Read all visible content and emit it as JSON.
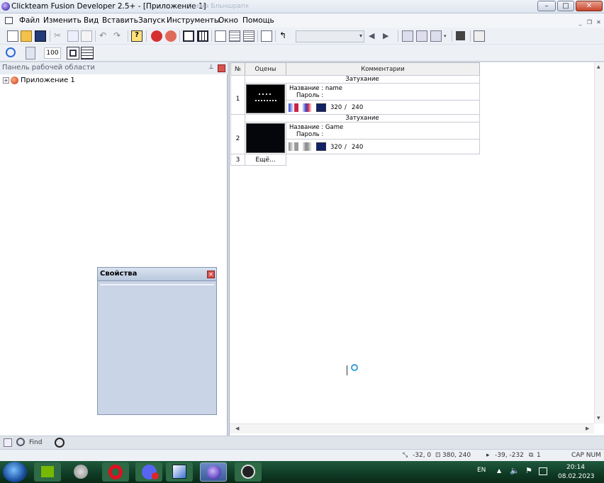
{
  "window": {
    "title": "Clickteam Fusion Developer 2.5+ - [Приложение 1]",
    "faded_tab": "Схема Бльншрапх"
  },
  "menu": {
    "items": [
      "Файл",
      "Изменить",
      "Вид",
      "Вставить",
      "Запуск",
      "Инструменты",
      "Окно",
      "Помощь"
    ]
  },
  "toolbar2": {
    "zoom_value": "100"
  },
  "workspace": {
    "header": "Панель рабочей области",
    "tree_root": "Приложение 1"
  },
  "properties": {
    "title": "Свойства"
  },
  "storyboard": {
    "columns": [
      "№",
      "Оцены",
      "Комментарии"
    ],
    "rows": [
      {
        "num": "1",
        "transition": "Затухание",
        "name_label": "Название : name",
        "password_label": "Пароль :",
        "width": "320",
        "slash": "/",
        "height": "240",
        "thumb_text": "п п п\nп п п п п п п"
      },
      {
        "num": "2",
        "transition": "Затухание",
        "name_label": "Название : Game",
        "password_label": "Пароль :",
        "width": "320",
        "slash": "/",
        "height": "240"
      }
    ],
    "more_row": {
      "num": "3",
      "label": "Ещё..."
    }
  },
  "findbar": {
    "placeholder": "Find"
  },
  "status": {
    "coord1": "-32, 0",
    "coord2": "380, 240",
    "coord3": "-39, -232",
    "layer": "1",
    "keys": "CAP NUM"
  },
  "taskbar": {
    "lang": "EN",
    "time": "20:14",
    "date": "08.02.2023"
  },
  "colors": {
    "taskbar": "#0f3a24",
    "panel_blue": "#c9d4e6",
    "close_red": "#c8452c"
  }
}
